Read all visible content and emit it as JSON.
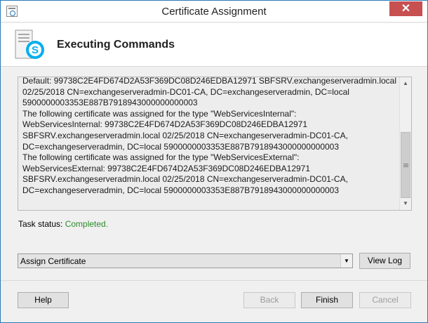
{
  "window": {
    "title": "Certificate Assignment",
    "close_glyph": "✕"
  },
  "header": {
    "title": "Executing Commands",
    "icon": "skype-server-icon"
  },
  "log": {
    "lines": [
      "Default: 99738C2E4FD674D2A53F369DC08D246EDBA12971 SBFSRV.exchangeserveradmin.local",
      "02/25/2018 CN=exchangeserveradmin-DC01-CA, DC=exchangeserveradmin, DC=local",
      "5900000003353E887B7918943000000000003",
      "The following certificate was assigned for the type \"WebServicesInternal\":",
      "WebServicesInternal: 99738C2E4FD674D2A53F369DC08D246EDBA12971",
      "SBFSRV.exchangeserveradmin.local 02/25/2018 CN=exchangeserveradmin-DC01-CA,",
      "DC=exchangeserveradmin, DC=local 5900000003353E887B7918943000000000003",
      "The following certificate was assigned for the type \"WebServicesExternal\":",
      "WebServicesExternal: 99738C2E4FD674D2A53F369DC08D246EDBA12971",
      "SBFSRV.exchangeserveradmin.local 02/25/2018 CN=exchangeserveradmin-DC01-CA,",
      "DC=exchangeserveradmin, DC=local 5900000003353E887B7918943000000000003"
    ]
  },
  "status": {
    "label": "Task status:",
    "value": "Completed."
  },
  "action_select": {
    "selected": "Assign Certificate"
  },
  "buttons": {
    "view_log": "View Log",
    "help": "Help",
    "back": "Back",
    "finish": "Finish",
    "cancel": "Cancel"
  },
  "colors": {
    "accent": "#2a7ab8",
    "status_ok": "#2b8a2b",
    "close": "#c75050",
    "skype": "#00aff0"
  }
}
